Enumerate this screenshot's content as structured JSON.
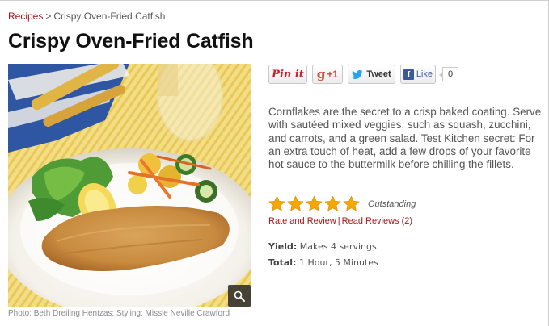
{
  "breadcrumb": {
    "root_label": "Recipes",
    "separator": ">",
    "current_label": "Crispy Oven-Fried Catfish"
  },
  "recipe": {
    "title": "Crispy Oven-Fried Catfish",
    "description": "Cornflakes are the secret to a crisp baked coating. Serve with sautéed mixed veggies, such as squash, zucchini, and carrots, and a green salad. Test Kitchen secret: For an extra touch of heat, add a few drops of your favorite hot sauce to the buttermilk before chilling the fillets.",
    "photo_credit": "Photo: Beth Dreiling Hentzas; Styling: Missie Neville Crawford",
    "zoom_icon": "magnifier-icon"
  },
  "share": {
    "pin_label": "Pin it",
    "gplus_g": "g",
    "gplus_label": "+1",
    "tweet_label": "Tweet",
    "fb_letter": "f",
    "like_label": "Like",
    "like_count": "0"
  },
  "rating": {
    "stars": 5,
    "max_stars": 5,
    "label": "Outstanding",
    "star_color": "#f5a800"
  },
  "review_links": {
    "rate_label": "Rate and Review",
    "separator": "|",
    "read_label": "Read Reviews (2)"
  },
  "details": {
    "yield_key": "Yield:",
    "yield_value": "Makes 4 servings",
    "total_key": "Total:",
    "total_value": "1 Hour, 5 Minutes"
  },
  "colors": {
    "link_red": "#a4161a",
    "facebook_blue": "#3b5998",
    "pinterest_red": "#c8232c",
    "gplus_red": "#d14836"
  }
}
